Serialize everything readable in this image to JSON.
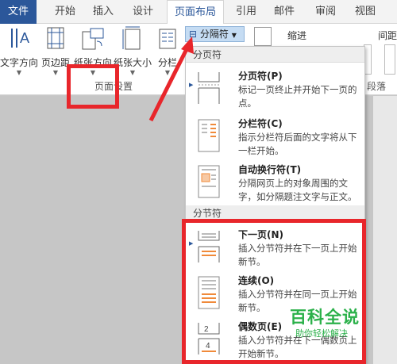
{
  "tabs": [
    {
      "label": "文件"
    },
    {
      "label": "开始"
    },
    {
      "label": "插入"
    },
    {
      "label": "设计"
    },
    {
      "label": "页面布局"
    },
    {
      "label": "引用"
    },
    {
      "label": "邮件"
    },
    {
      "label": "审阅"
    },
    {
      "label": "视图"
    }
  ],
  "ribbon": {
    "text_direction": "文字方向",
    "margins": "页边距",
    "orientation": "纸张方向",
    "size": "纸张大小",
    "columns": "分栏",
    "breaks": "分隔符",
    "indent": "缩进",
    "spacing": "间距",
    "page_setup_group": "页面设置",
    "paragraph_group": "段落"
  },
  "menu": {
    "page_breaks_header": "分页符",
    "section_breaks_header": "分节符",
    "items": [
      {
        "title": "分页符(P)",
        "desc": "标记一页终止并开始下一页的点。"
      },
      {
        "title": "分栏符(C)",
        "desc": "指示分栏符后面的文字将从下一栏开始。"
      },
      {
        "title": "自动换行符(T)",
        "desc": "分隔网页上的对象周围的文字，如分隔题注文字与正文。"
      },
      {
        "title": "下一页(N)",
        "desc": "插入分节符并在下一页上开始新节。"
      },
      {
        "title": "连续(O)",
        "desc": "插入分节符并在同一页上开始新节。"
      },
      {
        "title": "偶数页(E)",
        "desc": "插入分节符并在下一偶数页上开始新节。"
      }
    ]
  },
  "watermark": {
    "line1": "百科全说",
    "line2": "助你轻松解决"
  },
  "colors": {
    "accent": "#2b579a",
    "highlight": "#e8262b",
    "watermark": "#2bb14a"
  }
}
